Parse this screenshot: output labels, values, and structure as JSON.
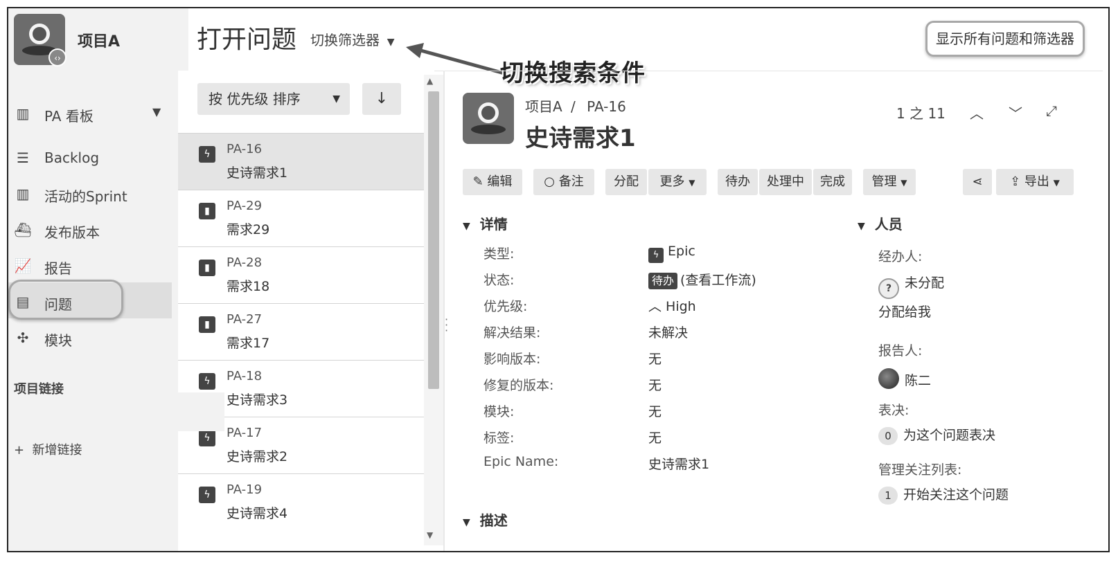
{
  "sidebar": {
    "project_name": "项目A",
    "items": [
      {
        "label": "PA 看板",
        "icon": "board-icon"
      },
      {
        "label": "Backlog",
        "icon": "backlog-icon"
      },
      {
        "label": "活动的Sprint",
        "icon": "sprint-icon"
      },
      {
        "label": "发布版本",
        "icon": "ship-icon"
      },
      {
        "label": "报告",
        "icon": "chart-icon"
      },
      {
        "label": "问题",
        "icon": "issues-icon"
      },
      {
        "label": "模块",
        "icon": "puzzle-icon"
      }
    ],
    "section_label": "项目链接",
    "add_link": "新增链接"
  },
  "header": {
    "title": "打开问题",
    "filter_switch": "切换筛选器",
    "show_all_button": "显示所有问题和筛选器",
    "annotation": "切换搜索条件"
  },
  "list": {
    "sort_label": "按 优先级 排序",
    "items": [
      {
        "key": "PA-16",
        "summary": "史诗需求1",
        "type": "epic",
        "selected": true
      },
      {
        "key": "PA-29",
        "summary": "需求29",
        "type": "story",
        "selected": false
      },
      {
        "key": "PA-28",
        "summary": "需求18",
        "type": "story",
        "selected": false
      },
      {
        "key": "PA-27",
        "summary": "需求17",
        "type": "story",
        "selected": false
      },
      {
        "key": "PA-18",
        "summary": "史诗需求3",
        "type": "epic",
        "selected": false
      },
      {
        "key": "PA-17",
        "summary": "史诗需求2",
        "type": "epic",
        "selected": false
      },
      {
        "key": "PA-19",
        "summary": "史诗需求4",
        "type": "epic",
        "selected": false
      }
    ]
  },
  "detail": {
    "breadcrumb_project": "项目A",
    "breadcrumb_sep": "/",
    "breadcrumb_key": "PA-16",
    "title": "史诗需求1",
    "pager": "1 之 11",
    "toolbar": {
      "edit": "编辑",
      "comment": "备注",
      "assign": "分配",
      "more": "更多",
      "todo": "待办",
      "in_progress": "处理中",
      "done": "完成",
      "admin": "管理",
      "export": "导出"
    },
    "details_heading": "详情",
    "fields": [
      {
        "label": "类型:",
        "value": "Epic"
      },
      {
        "label": "状态:",
        "value": "(查看工作流)",
        "badge": "待办"
      },
      {
        "label": "优先级:",
        "value": "High"
      },
      {
        "label": "解决结果:",
        "value": "未解决"
      },
      {
        "label": "影响版本:",
        "value": "无"
      },
      {
        "label": "修复的版本:",
        "value": "无"
      },
      {
        "label": "模块:",
        "value": "无"
      },
      {
        "label": "标签:",
        "value": "无"
      },
      {
        "label": "Epic Name:",
        "value": "史诗需求1"
      }
    ],
    "description_heading": "描述",
    "people": {
      "heading": "人员",
      "assignee_label": "经办人:",
      "assignee_value": "未分配",
      "assign_to_me": "分配给我",
      "reporter_label": "报告人:",
      "reporter_value": "陈二",
      "votes_label": "表决:",
      "votes_count": "0",
      "votes_text": "为这个问题表决",
      "watchers_label": "管理关注列表:",
      "watchers_count": "1",
      "watchers_text": "开始关注这个问题"
    }
  }
}
